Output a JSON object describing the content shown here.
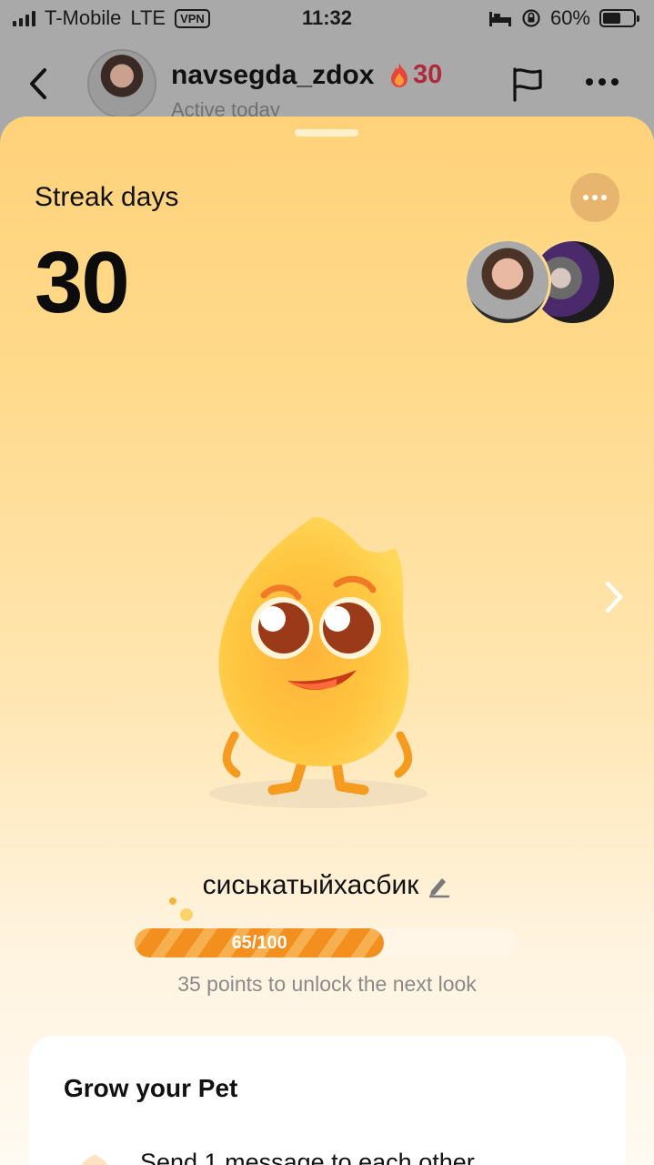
{
  "status_bar": {
    "carrier": "T-Mobile",
    "network": "LTE",
    "vpn_label": "VPN",
    "time": "11:32",
    "battery": "60%"
  },
  "chat_header": {
    "username": "navsegda_zdox",
    "streak_count": "30",
    "status": "Active today"
  },
  "sheet": {
    "streak_label": "Streak days",
    "streak_number": "30",
    "pet_name": "сиськатыйхасбик",
    "progress_text": "65/100",
    "progress_fraction": 0.65,
    "unlock_text": "35 points to unlock the next look"
  },
  "grow_card": {
    "title": "Grow your Pet",
    "task_text": "Send 1 message to each other"
  },
  "colors": {
    "accent_orange": "#f38f1f",
    "streak_red": "#b0293a",
    "sheet_top": "#ffd27a"
  }
}
